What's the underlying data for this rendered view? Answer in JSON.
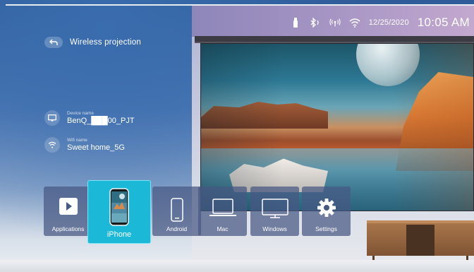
{
  "status_bar": {
    "icons": [
      "usb-icon",
      "bluetooth-icon",
      "antenna-icon",
      "wifi-icon"
    ],
    "date": "12/25/2020",
    "time": "10:05 AM"
  },
  "header": {
    "back_icon": "back-arrow-icon",
    "title": "Wireless projection"
  },
  "device": {
    "icon": "cast-screen-icon",
    "caption": "Device name",
    "name": "BenQ_███00_PJT"
  },
  "wifi": {
    "icon": "wifi-icon",
    "caption": "Wifi name",
    "name": "Sweet home_5G"
  },
  "apps": [
    {
      "label": "Applications",
      "icon": "play-icon",
      "selected": false
    },
    {
      "label": "iPhone",
      "icon": "iphone-icon",
      "selected": true
    },
    {
      "label": "Android",
      "icon": "android-phone-icon",
      "selected": false
    },
    {
      "label": "Mac",
      "icon": "laptop-icon",
      "selected": false
    },
    {
      "label": "Windows",
      "icon": "monitor-icon",
      "selected": false
    },
    {
      "label": "Settings",
      "icon": "gear-icon",
      "selected": false
    }
  ],
  "colors": {
    "accent": "#1cb8d8",
    "tile_bg": "#465882"
  }
}
